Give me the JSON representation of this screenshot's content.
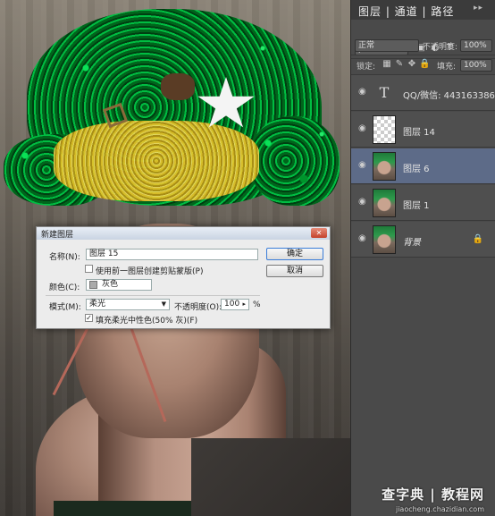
{
  "panel": {
    "title": "图层 | 通道 | 路径",
    "kind_filter": "ρ 类型",
    "blend_mode": "正常",
    "opacity_label": "不透明度:",
    "opacity_value": "100%",
    "lock_label": "锁定:",
    "fill_label": "填充:",
    "fill_value": "100%",
    "layers": [
      {
        "name": "QQ/微信: 443163386",
        "kind": "type",
        "visible": true,
        "selected": false
      },
      {
        "name": "图层 14",
        "kind": "transparent",
        "visible": true,
        "selected": false
      },
      {
        "name": "图层 6",
        "kind": "photo",
        "visible": true,
        "selected": true
      },
      {
        "name": "图层 1",
        "kind": "photo",
        "visible": true,
        "selected": false
      },
      {
        "name": "背景",
        "kind": "photo",
        "visible": true,
        "selected": false,
        "locked": true
      }
    ]
  },
  "dialog": {
    "title": "新建图层",
    "name_label": "名称(N):",
    "name_value": "图层 15",
    "clip_label": "使用前一图层创建剪贴蒙版(P)",
    "clip_checked": false,
    "color_label": "颜色(C):",
    "color_value": "灰色",
    "mode_label": "模式(M):",
    "mode_value": "柔光",
    "opacity_label": "不透明度(O):",
    "opacity_value": "100",
    "opacity_unit": "%",
    "fill_label": "填充柔光中性色(50% 灰)(F)",
    "fill_checked": true,
    "ok_label": "确定",
    "cancel_label": "取消",
    "close_label": "✕"
  },
  "watermark": {
    "main": "查字典 | 教程网",
    "sub": "jiaocheng.chazidian.com"
  },
  "colors": {
    "panel_bg": "#4a4a4a",
    "selected_layer": "#5d6b88",
    "arrow": "#b5685a",
    "tinsel_green": "#1fb253",
    "tinsel_gold": "#e8c52a"
  }
}
